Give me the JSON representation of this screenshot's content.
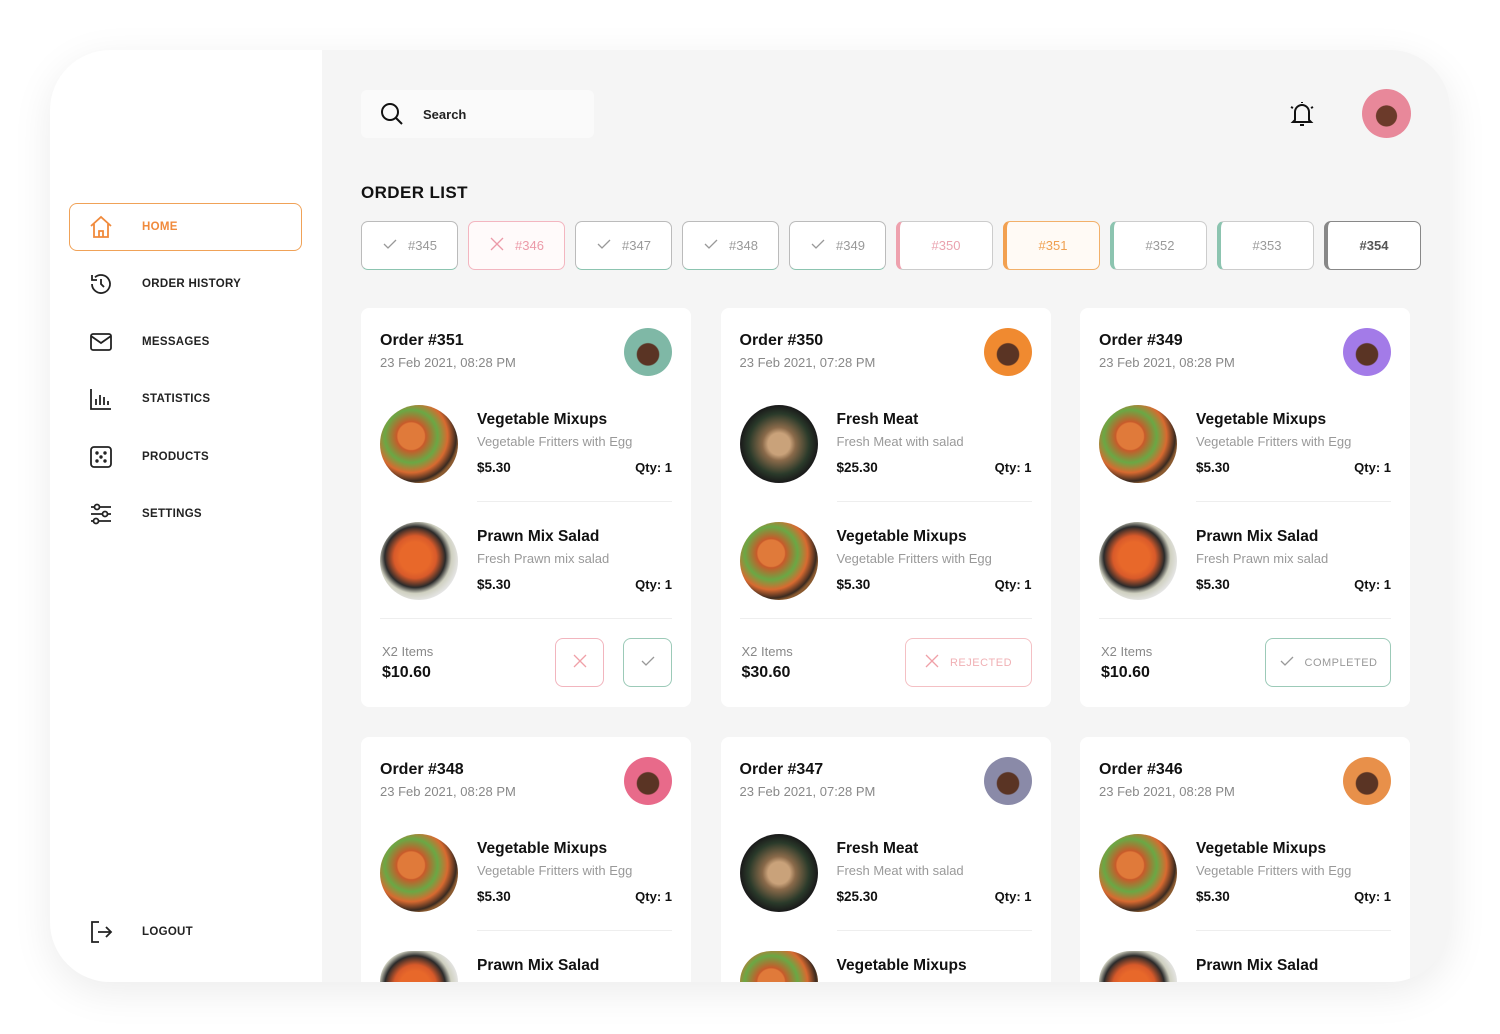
{
  "sidebar": {
    "items": [
      {
        "label": "HOME",
        "icon": "home-icon",
        "active": true
      },
      {
        "label": "ORDER HISTORY",
        "icon": "history-icon"
      },
      {
        "label": "MESSAGES",
        "icon": "mail-icon"
      },
      {
        "label": "STATISTICS",
        "icon": "chart-icon"
      },
      {
        "label": "PRODUCTS",
        "icon": "products-icon"
      },
      {
        "label": "SETTINGS",
        "icon": "sliders-icon"
      }
    ],
    "logout": "LOGOUT"
  },
  "header": {
    "search_placeholder": "Search"
  },
  "title": "ORDER LIST",
  "chips": [
    {
      "label": "#345",
      "status": "completed"
    },
    {
      "label": "#346",
      "status": "rejected"
    },
    {
      "label": "#347",
      "status": "completed"
    },
    {
      "label": "#348",
      "status": "completed"
    },
    {
      "label": "#349",
      "status": "completed"
    },
    {
      "label": "#350",
      "status": "pink"
    },
    {
      "label": "#351",
      "status": "orange"
    },
    {
      "label": "#352",
      "status": "teal"
    },
    {
      "label": "#353",
      "status": "teal"
    },
    {
      "label": "#354",
      "status": "dark"
    }
  ],
  "colors": {
    "accent": "#f08a3c",
    "reject": "#f0a0a8",
    "complete": "#8cc4b0"
  },
  "orders": [
    {
      "title": "Order #351",
      "date": "23 Feb 2021, 08:28 PM",
      "avatar": "#7fb8a6",
      "items": [
        {
          "name": "Vegetable  Mixups",
          "desc": "Vegetable Fritters with Egg",
          "price": "$5.30",
          "qty": "Qty: 1",
          "food": "veg"
        },
        {
          "name": "Prawn Mix Salad",
          "desc": "Fresh Prawn mix salad",
          "price": "$5.30",
          "qty": "Qty: 1",
          "food": "prawn"
        }
      ],
      "count": "X2 Items",
      "total": "$10.60",
      "action": "pending"
    },
    {
      "title": "Order #350",
      "date": "23 Feb 2021, 07:28 PM",
      "avatar": "#f08a30",
      "items": [
        {
          "name": "Fresh Meat",
          "desc": "Fresh Meat with salad",
          "price": "$25.30",
          "qty": "Qty: 1",
          "food": "meat"
        },
        {
          "name": "Vegetable  Mixups",
          "desc": "Vegetable Fritters with Egg",
          "price": "$5.30",
          "qty": "Qty: 1",
          "food": "veg"
        }
      ],
      "count": "X2 Items",
      "total": "$30.60",
      "action": "rejected",
      "action_label": "REJECTED"
    },
    {
      "title": "Order #349",
      "date": "23 Feb 2021, 08:28 PM",
      "avatar": "#a37be8",
      "items": [
        {
          "name": "Vegetable  Mixups",
          "desc": "Vegetable Fritters with Egg",
          "price": "$5.30",
          "qty": "Qty: 1",
          "food": "veg"
        },
        {
          "name": "Prawn Mix Salad",
          "desc": "Fresh Prawn mix salad",
          "price": "$5.30",
          "qty": "Qty: 1",
          "food": "prawn"
        }
      ],
      "count": "X2 Items",
      "total": "$10.60",
      "action": "completed",
      "action_label": "COMPLETED"
    },
    {
      "title": "Order #348",
      "date": "23 Feb 2021, 08:28 PM",
      "avatar": "#e86a8a",
      "items": [
        {
          "name": "Vegetable  Mixups",
          "desc": "Vegetable Fritters with Egg",
          "price": "$5.30",
          "qty": "Qty: 1",
          "food": "veg"
        },
        {
          "name": "Prawn Mix Salad",
          "desc": "",
          "price": "",
          "qty": "",
          "food": "prawn"
        }
      ]
    },
    {
      "title": "Order #347",
      "date": "23 Feb 2021, 07:28 PM",
      "avatar": "#8a8aa8",
      "items": [
        {
          "name": "Fresh Meat",
          "desc": "Fresh Meat with salad",
          "price": "$25.30",
          "qty": "Qty: 1",
          "food": "meat"
        },
        {
          "name": "Vegetable  Mixups",
          "desc": "",
          "price": "",
          "qty": "",
          "food": "veg"
        }
      ]
    },
    {
      "title": "Order #346",
      "date": "23 Feb 2021, 08:28 PM",
      "avatar": "#e8904a",
      "items": [
        {
          "name": "Vegetable  Mixups",
          "desc": "Vegetable Fritters with Egg",
          "price": "$5.30",
          "qty": "Qty: 1",
          "food": "veg"
        },
        {
          "name": "Prawn Mix Salad",
          "desc": "",
          "price": "",
          "qty": "",
          "food": "prawn"
        }
      ]
    }
  ]
}
